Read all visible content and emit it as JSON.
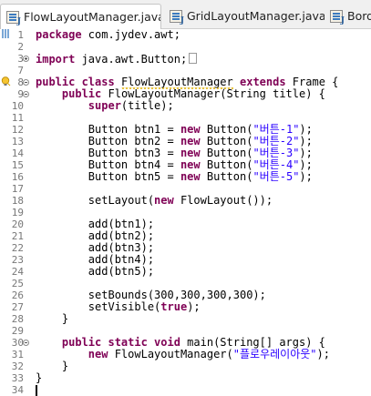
{
  "tabs": [
    {
      "label": "FlowLayoutManager.java",
      "active": true,
      "close": "✕"
    },
    {
      "label": "GridLayoutManager.java",
      "active": false
    },
    {
      "label": "Bord",
      "active": false
    }
  ],
  "editor": {
    "lines": [
      {
        "n": "1",
        "tokens": [
          {
            "t": "kw",
            "v": "package"
          },
          {
            "t": "p",
            "v": " com.jydev.awt;"
          }
        ]
      },
      {
        "n": "2",
        "tokens": []
      },
      {
        "n": "3",
        "tokens": [
          {
            "t": "kw",
            "v": "import"
          },
          {
            "t": "p",
            "v": " java.awt.Button;"
          }
        ]
      },
      {
        "n": "7",
        "tokens": []
      },
      {
        "n": "8",
        "tokens": [
          {
            "t": "kw",
            "v": "public class"
          },
          {
            "t": "p",
            "v": " "
          },
          {
            "t": "sq",
            "v": "FlowLayoutManager"
          },
          {
            "t": "p",
            "v": " "
          },
          {
            "t": "kw",
            "v": "extends"
          },
          {
            "t": "p",
            "v": " Frame {"
          }
        ]
      },
      {
        "n": "9",
        "tokens": [
          {
            "t": "p",
            "v": "    "
          },
          {
            "t": "kw",
            "v": "public"
          },
          {
            "t": "p",
            "v": " FlowLayoutManager(String title) {"
          }
        ]
      },
      {
        "n": "10",
        "tokens": [
          {
            "t": "p",
            "v": "        "
          },
          {
            "t": "kw",
            "v": "super"
          },
          {
            "t": "p",
            "v": "(title);"
          }
        ]
      },
      {
        "n": "11",
        "tokens": []
      },
      {
        "n": "12",
        "tokens": [
          {
            "t": "p",
            "v": "        Button btn1 = "
          },
          {
            "t": "kw",
            "v": "new"
          },
          {
            "t": "p",
            "v": " Button("
          },
          {
            "t": "str",
            "v": "\"버튼-1\""
          },
          {
            "t": "p",
            "v": ");"
          }
        ]
      },
      {
        "n": "13",
        "tokens": [
          {
            "t": "p",
            "v": "        Button btn2 = "
          },
          {
            "t": "kw",
            "v": "new"
          },
          {
            "t": "p",
            "v": " Button("
          },
          {
            "t": "str",
            "v": "\"버튼-2\""
          },
          {
            "t": "p",
            "v": ");"
          }
        ]
      },
      {
        "n": "14",
        "tokens": [
          {
            "t": "p",
            "v": "        Button btn3 = "
          },
          {
            "t": "kw",
            "v": "new"
          },
          {
            "t": "p",
            "v": " Button("
          },
          {
            "t": "str",
            "v": "\"버튼-3\""
          },
          {
            "t": "p",
            "v": ");"
          }
        ]
      },
      {
        "n": "15",
        "tokens": [
          {
            "t": "p",
            "v": "        Button btn4 = "
          },
          {
            "t": "kw",
            "v": "new"
          },
          {
            "t": "p",
            "v": " Button("
          },
          {
            "t": "str",
            "v": "\"버튼-4\""
          },
          {
            "t": "p",
            "v": ");"
          }
        ]
      },
      {
        "n": "16",
        "tokens": [
          {
            "t": "p",
            "v": "        Button btn5 = "
          },
          {
            "t": "kw",
            "v": "new"
          },
          {
            "t": "p",
            "v": " Button("
          },
          {
            "t": "str",
            "v": "\"버튼-5\""
          },
          {
            "t": "p",
            "v": ");"
          }
        ]
      },
      {
        "n": "17",
        "tokens": []
      },
      {
        "n": "18",
        "tokens": [
          {
            "t": "p",
            "v": "        setLayout("
          },
          {
            "t": "kw",
            "v": "new"
          },
          {
            "t": "p",
            "v": " FlowLayout());"
          }
        ]
      },
      {
        "n": "19",
        "tokens": []
      },
      {
        "n": "20",
        "tokens": [
          {
            "t": "p",
            "v": "        add(btn1);"
          }
        ]
      },
      {
        "n": "21",
        "tokens": [
          {
            "t": "p",
            "v": "        add(btn2);"
          }
        ]
      },
      {
        "n": "22",
        "tokens": [
          {
            "t": "p",
            "v": "        add(btn3);"
          }
        ]
      },
      {
        "n": "23",
        "tokens": [
          {
            "t": "p",
            "v": "        add(btn4);"
          }
        ]
      },
      {
        "n": "24",
        "tokens": [
          {
            "t": "p",
            "v": "        add(btn5);"
          }
        ]
      },
      {
        "n": "25",
        "tokens": []
      },
      {
        "n": "26",
        "tokens": [
          {
            "t": "p",
            "v": "        setBounds(300,300,300,300);"
          }
        ]
      },
      {
        "n": "27",
        "tokens": [
          {
            "t": "p",
            "v": "        setVisible("
          },
          {
            "t": "kw",
            "v": "true"
          },
          {
            "t": "p",
            "v": ");"
          }
        ]
      },
      {
        "n": "28",
        "tokens": [
          {
            "t": "p",
            "v": "    }"
          }
        ]
      },
      {
        "n": "29",
        "tokens": []
      },
      {
        "n": "30",
        "tokens": [
          {
            "t": "p",
            "v": "    "
          },
          {
            "t": "kw",
            "v": "public static void"
          },
          {
            "t": "p",
            "v": " main(String[] args) {"
          }
        ]
      },
      {
        "n": "31",
        "tokens": [
          {
            "t": "p",
            "v": "        "
          },
          {
            "t": "kw",
            "v": "new"
          },
          {
            "t": "p",
            "v": " FlowLayoutManager("
          },
          {
            "t": "str",
            "v": "\"플로우레이아웃\""
          },
          {
            "t": "p",
            "v": ");"
          }
        ]
      },
      {
        "n": "32",
        "tokens": [
          {
            "t": "p",
            "v": "    }"
          }
        ]
      },
      {
        "n": "33",
        "tokens": [
          {
            "t": "p",
            "v": "}"
          }
        ]
      },
      {
        "n": "34",
        "tokens": []
      }
    ]
  },
  "colors": {
    "keyword": "#7f0055",
    "string": "#2a00ff",
    "line_number": "#777777"
  }
}
